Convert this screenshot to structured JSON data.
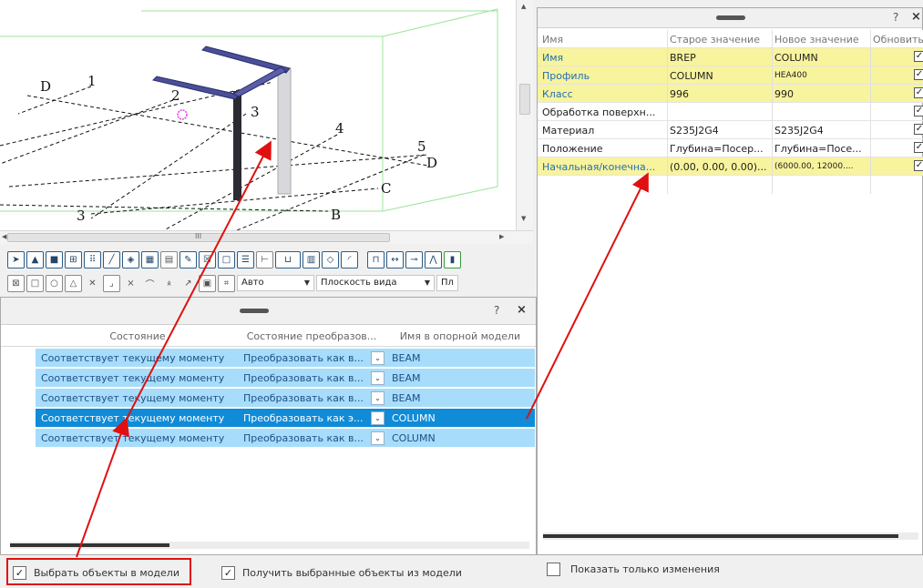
{
  "viewport": {
    "grid_labels": [
      "D",
      "1",
      "2",
      "3",
      "4",
      "5",
      "D",
      "C",
      "3",
      "B"
    ],
    "scroll_thumb_label": "III"
  },
  "toolbar": {
    "row1_icons": [
      "pointer-icon",
      "solid-icon",
      "square-icon",
      "grid-icon",
      "snap-icon",
      "line-icon",
      "cube-icon",
      "table-icon",
      "hatch-icon",
      "pencil-icon",
      "x-box-icon",
      "panel-icon",
      "ruler-icon",
      "rect-icon",
      "layer-icon",
      "eye-icon",
      "curve-icon",
      "frame-icon",
      "link-icon",
      "chain-icon",
      "arc-icon"
    ],
    "row2_icons": [
      "box-x-icon",
      "box-icon",
      "circle-icon",
      "triangle-icon",
      "x-icon",
      "corner-icon",
      "x-mark-icon",
      "wave-icon",
      "x-under-icon",
      "arrow-icon",
      "square-filled-icon",
      "grid-box-icon"
    ],
    "combo_auto": "Авто",
    "combo_plane": "Плоскость вида",
    "combo_extra": "Пл"
  },
  "left_panel": {
    "help": "?",
    "close": "×",
    "columns": [
      "Состояние",
      "Состояние преобразов...",
      "Имя в опорной модели"
    ],
    "rows": [
      {
        "state": "Соответствует текущему моменту",
        "conversion": "Преобразовать как в...",
        "name": "BEAM",
        "selected": false
      },
      {
        "state": "Соответствует текущему моменту",
        "conversion": "Преобразовать как в...",
        "name": "BEAM",
        "selected": false
      },
      {
        "state": "Соответствует текущему моменту",
        "conversion": "Преобразовать как в...",
        "name": "BEAM",
        "selected": false
      },
      {
        "state": "Соответствует текущему моменту",
        "conversion": "Преобразовать как э...",
        "name": "COLUMN",
        "selected": true
      },
      {
        "state": "Соответствует текущему моменту",
        "conversion": "Преобразовать как в...",
        "name": "COLUMN",
        "selected": false
      }
    ]
  },
  "right_panel": {
    "help": "?",
    "close": "×",
    "columns": [
      "Имя",
      "Старое значение",
      "Новое значение",
      "Обновить"
    ],
    "rows": [
      {
        "name": "Имя",
        "old": "BREP",
        "new": "COLUMN",
        "checked": true,
        "highlight": true
      },
      {
        "name": "Профиль",
        "old": "COLUMN",
        "new": "HEA400",
        "checked": true,
        "highlight": true
      },
      {
        "name": "Класс",
        "old": "996",
        "new": "990",
        "checked": true,
        "highlight": true
      },
      {
        "name": "Обработка поверхн...",
        "old": "",
        "new": "",
        "checked": true,
        "highlight": false
      },
      {
        "name": "Материал",
        "old": "S235J2G4",
        "new": "S235J2G4",
        "checked": true,
        "highlight": false
      },
      {
        "name": "Положение",
        "old": "Глубина=Посер...",
        "new": "Глубина=Посе...",
        "checked": true,
        "highlight": false
      },
      {
        "name": "Начальная/конечна...",
        "old": "(0.00, 0.00, 0.00)...",
        "new": "(6000.00, 12000....",
        "checked": true,
        "highlight": true
      }
    ]
  },
  "bottom": {
    "select_in_model": "Выбрать объекты в модели",
    "get_selected": "Получить выбранные объекты из модели",
    "show_changes_only": "Показать только изменения",
    "select_in_model_checked": true,
    "get_selected_checked": true,
    "show_changes_only_checked": false
  },
  "colors": {
    "row_blue": "#a7ddfb",
    "row_selected": "#0f8bd8",
    "highlight_yellow": "#f8f39d",
    "annotation_red": "#e01010",
    "beam_purple": "#4b4f9a"
  }
}
